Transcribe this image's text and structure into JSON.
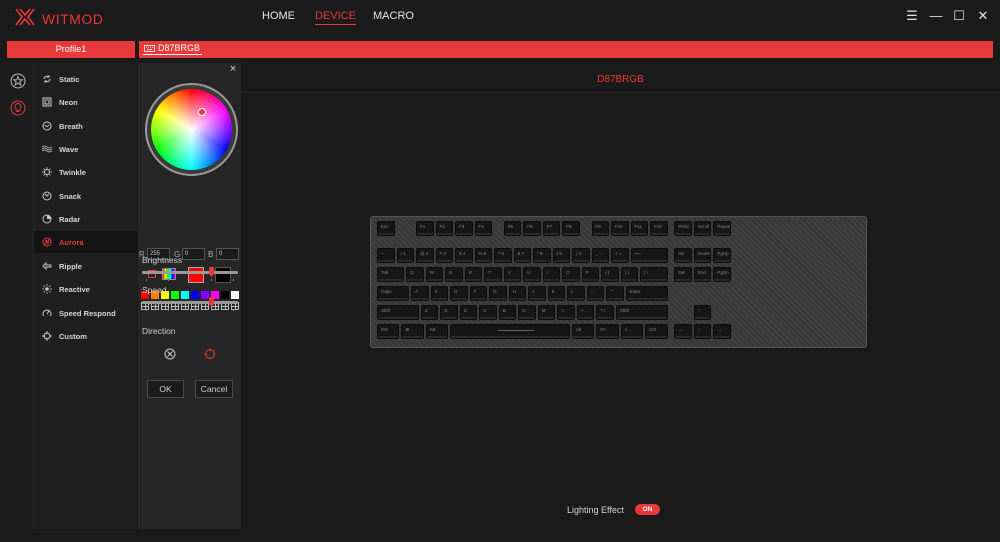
{
  "app": {
    "brand": "WITMOD",
    "accent_color": "#e8393b"
  },
  "nav": {
    "home": "HOME",
    "device": "DEVICE",
    "macro": "MACRO"
  },
  "window_controls": {
    "menu": "☰",
    "minimize": "—",
    "maximize": "☐",
    "close": "✕"
  },
  "profile": {
    "name": "Profile1"
  },
  "device": {
    "name": "D87BRGB"
  },
  "effects": [
    {
      "label": "Static",
      "icon": "cycle-arrows-icon"
    },
    {
      "label": "Neon",
      "icon": "square-frame-icon"
    },
    {
      "label": "Breath",
      "icon": "breath-icon"
    },
    {
      "label": "Wave",
      "icon": "wave-icon"
    },
    {
      "label": "Twinkle",
      "icon": "sparkle-icon"
    },
    {
      "label": "Snack",
      "icon": "snake-icon"
    },
    {
      "label": "Radar",
      "icon": "radar-icon"
    },
    {
      "label": "Aurora",
      "icon": "aurora-icon",
      "active": true
    },
    {
      "label": "Ripple",
      "icon": "ripple-icon"
    },
    {
      "label": "Reactive",
      "icon": "reactive-icon"
    },
    {
      "label": "Speed Respond",
      "icon": "speedometer-icon"
    },
    {
      "label": "Custom",
      "icon": "crosshair-icon"
    }
  ],
  "color_panel": {
    "close": "×",
    "r_label": "R",
    "g_label": "G",
    "b_label": "B",
    "r": "255",
    "g": "0",
    "b": "0",
    "current_color": "#ff0000",
    "swatches": [
      "#ff0000",
      "#ff7f00",
      "#ffff00",
      "#00ff00",
      "#00ffff",
      "#0000ff",
      "#8000ff",
      "#ff00ff",
      "#000000",
      "#ffffff"
    ],
    "brightness_label": "Brightness",
    "brightness_level": 0.72,
    "speed_label": "Speed",
    "speed_level": 0.72,
    "direction_label": "Direction",
    "ok_label": "OK",
    "cancel_label": "Cancel"
  },
  "keyboard": {
    "rows": [
      [
        "Esc",
        "F1",
        "F2",
        "F3",
        "F4",
        "F5",
        "F6",
        "F7",
        "F8",
        "F9",
        "F10",
        "F11",
        "F12",
        "PrtSc",
        "Scroll",
        "Pause"
      ],
      [
        "~ `",
        "! 1",
        "@ 2",
        "# 3",
        "$ 4",
        "% 5",
        "^ 6",
        "& 7",
        "* 8",
        "( 9",
        ") 0",
        "_ -",
        "+ =",
        "⟵",
        "Ins",
        "Home",
        "PgUp"
      ],
      [
        "Tab",
        "Q",
        "W",
        "E",
        "R",
        "T",
        "Y",
        "U",
        "I",
        "O",
        "P",
        "{ [",
        "} ]",
        "| \\",
        "Del",
        "End",
        "PgDn"
      ],
      [
        "Caps",
        "A",
        "S",
        "D",
        "F",
        "G",
        "H",
        "J",
        "K",
        "L",
        ": ;",
        "\" '",
        "Enter"
      ],
      [
        "Shift",
        "Z",
        "X",
        "C",
        "V",
        "B",
        "N",
        "M",
        "< ,",
        "> .",
        "? /",
        "Shift",
        "↑"
      ],
      [
        "Ctrl",
        "⊞",
        "Alt",
        "",
        "Alt",
        "Fn",
        "≡",
        "Ctrl",
        "←",
        "↓",
        "→"
      ]
    ]
  },
  "lighting": {
    "label": "Lighting Effect",
    "state": "ON"
  }
}
